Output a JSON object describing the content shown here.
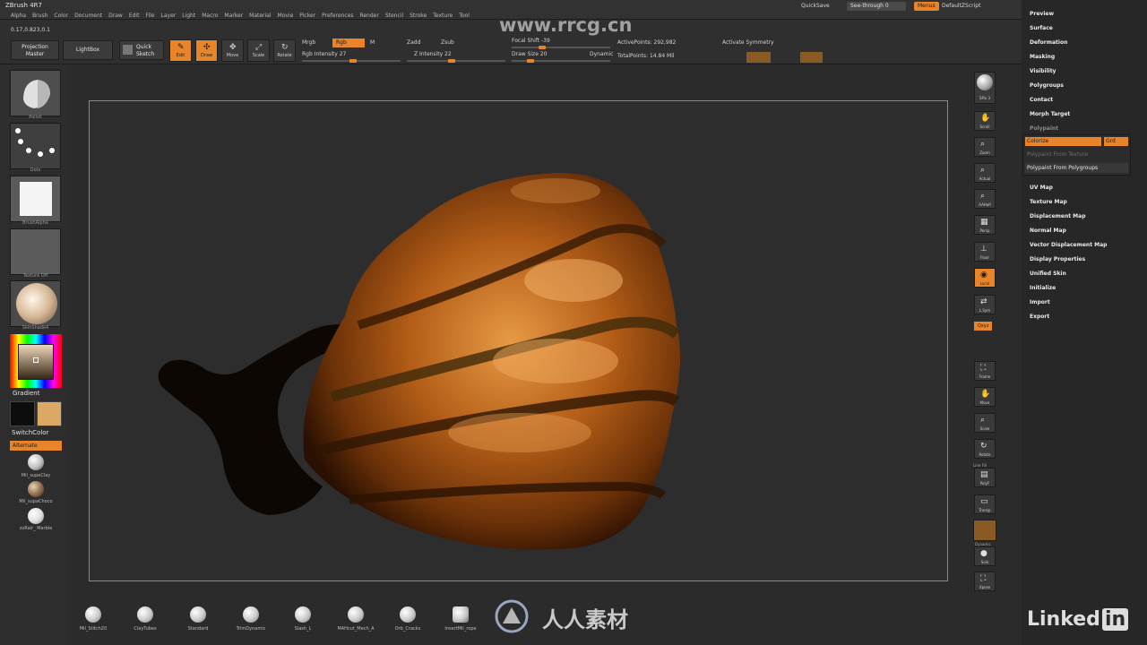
{
  "app": {
    "title": "ZBrush 4R7"
  },
  "menubar": {
    "items": [
      "Alpha",
      "Brush",
      "Color",
      "Document",
      "Draw",
      "Edit",
      "File",
      "Layer",
      "Light",
      "Macro",
      "Marker",
      "Material",
      "Movie",
      "Picker",
      "Preferences",
      "Render",
      "Stencil",
      "Stroke",
      "Texture",
      "Tool"
    ],
    "quicksave": "QuickSave",
    "seethrough": "See-through  0",
    "menus": "Menus",
    "defaultscript": "DefaultZScript"
  },
  "toolbar": {
    "coords": "0.17,0.823,0.1",
    "projection_master": "Projection Master",
    "lightbox": "LightBox",
    "quick_sketch": "Quick Sketch",
    "edit": "Edit",
    "draw": "Draw",
    "move": "Move",
    "scale": "Scale",
    "rotate": "Rotate",
    "mrgb": "Mrgb",
    "rgb": "Rgb",
    "m": "M",
    "rgb_intensity": "Rgb Intensity 27",
    "zadd": "Zadd",
    "zsub": "Zsub",
    "z_intensity": "Z Intensity 22",
    "focal_shift": "Focal Shift -39",
    "draw_size": "Draw Size 20",
    "dynamic": "Dynamic",
    "active_points": "ActivePoints: 292,982",
    "total_points": "TotalPoints: 14.84 Mil",
    "activate_symmetry": "Activate Symmetry"
  },
  "left_shelf": {
    "brush_cap": "Polish",
    "stroke_cap": "Dots",
    "alpha_cap": "BrushAlpha",
    "texture_cap": "Texture Off",
    "material_cap": "SkinShade4",
    "gradient": "Gradient",
    "switchcolor": "SwitchColor",
    "alternate": "Alternate",
    "materials": [
      "Mil_supeClay",
      "Mil_supaChoco",
      "zvRair_ Marble"
    ]
  },
  "right_shelf": {
    "spix": "SPix 3",
    "scroll": "Scroll",
    "zoom": "Zoom",
    "actual": "Actual",
    "aahalf": "AAHalf",
    "persp": "Persp",
    "floor": "Floor",
    "local": "Local",
    "lsym": "L.Sym",
    "xyz": "Qxyz",
    "frame": "Frame",
    "move": "Move",
    "scale": "Scale",
    "rotate": "Rotate",
    "polyf": "PolyF",
    "transp": "Transp",
    "solo": "Solo",
    "xpose": "Xpose",
    "line_fill": "Line Fill",
    "dynamic": "Dynamic"
  },
  "right_panel": {
    "items_top": [
      "Preview",
      "Surface",
      "Deformation",
      "Masking",
      "Visibility",
      "Polygroups",
      "Contact",
      "Morph Target",
      "Polypaint"
    ],
    "colorize": "Colorize",
    "grd": "Grd",
    "polypaint_from_texture": "Polypaint From Texture",
    "polypaint_from_polygroups": "Polypaint From Polygroups",
    "items_bottom": [
      "UV Map",
      "Texture Map",
      "Displacement Map",
      "Normal Map",
      "Vector Displacement Map",
      "Display Properties",
      "Unified Skin",
      "Initialize",
      "Import",
      "Export"
    ]
  },
  "brushes": [
    "Mil_Stitch20",
    "ClayTubes",
    "Standard",
    "TrimDynamic",
    "Slash_L",
    "MAHcut_Mech_A",
    "Orb_Cracks",
    "InsertMil_rope"
  ],
  "watermarks": {
    "rrcg_top": "www.rrcg.cn",
    "cn_bottom": "人人素材",
    "linkedin": "Linked",
    "linkedin_in": "in"
  },
  "colors": {
    "accent": "#e8842a",
    "background": "#2b2b2b"
  }
}
